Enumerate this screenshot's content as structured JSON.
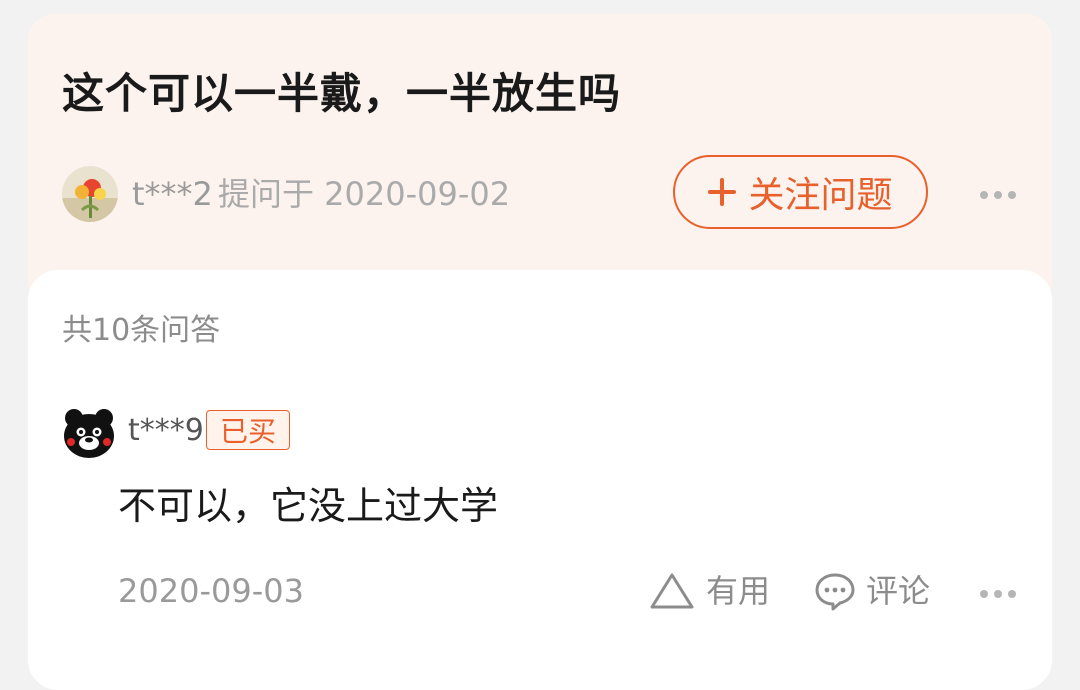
{
  "question": {
    "title": "这个可以一半戴，一半放生吗",
    "asker_name": "t***2",
    "asked_meta": "提问于 2020-09-02",
    "follow_label": "关注问题"
  },
  "answers": {
    "count_label": "共10条问答",
    "items": [
      {
        "user": "t***9",
        "badge": "已买",
        "text": "不可以，它没上过大学",
        "date": "2020-09-03",
        "useful_label": "有用",
        "comment_label": "评论"
      }
    ]
  },
  "colors": {
    "accent": "#e8602c",
    "question_bg": "#fcf3ee",
    "page_bg": "#f2f2f2"
  },
  "icons": [
    "plus-icon",
    "more-icon",
    "useful-icon",
    "comment-icon"
  ]
}
